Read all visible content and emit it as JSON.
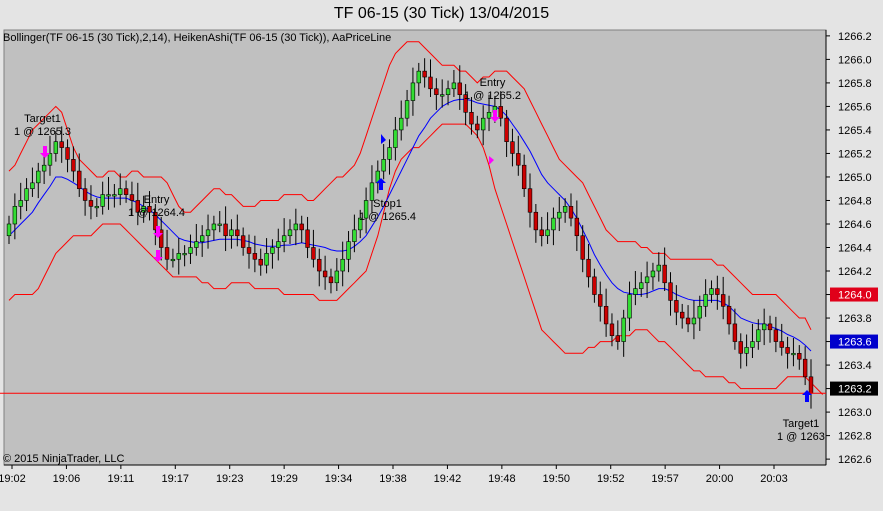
{
  "window": {
    "title": "TF 06-15 (30 Tick)  13/04/2015"
  },
  "indicators_label": "Bollinger(TF 06-15 (30 Tick),2,14), HeikenAshi(TF 06-15 (30 Tick)), AaPriceLine",
  "copyright": "© 2015 NinjaTrader, LLC",
  "colors": {
    "background": "#c0c0c0",
    "up_candle": "#33dd33",
    "down_candle": "#cc0000",
    "bollinger_band": "#ff0000",
    "bollinger_mid": "#0000ff",
    "signal_arrow": "#ff00ff",
    "stop_arrow": "#0000ff"
  },
  "annotations": [
    {
      "id": "target1_left",
      "line1": "Target1",
      "line2": "1 @ 1265.3"
    },
    {
      "id": "entry_left",
      "line1": "Entry",
      "line2": "1 @ 1264.4"
    },
    {
      "id": "stop1",
      "line1": "Stop1",
      "line2": "1 @ 1265.4"
    },
    {
      "id": "entry_right",
      "line1": "Entry",
      "line2": "1 @ 1265.2"
    },
    {
      "id": "target1_right",
      "line1": "Target1",
      "line2": "1 @ 1263"
    }
  ],
  "price_tags": [
    {
      "label": "1264.0",
      "value": 1264.0,
      "bg": "#e0001a",
      "fg": "#ffffff"
    },
    {
      "label": "1263.6",
      "value": 1263.6,
      "bg": "#0000cc",
      "fg": "#ffffff"
    },
    {
      "label": "1263.2",
      "value": 1263.2,
      "bg": "#000000",
      "fg": "#ffffff"
    }
  ],
  "chart_data": {
    "type": "candlestick",
    "title": "TF 06-15 (30 Tick)  13/04/2015",
    "ylim": [
      1262.55,
      1266.25
    ],
    "y_ticks": [
      "1262.6",
      "1262.8",
      "1263.0",
      "1263.2",
      "1263.4",
      "1263.6",
      "1263.8",
      "1264.0",
      "1264.2",
      "1264.4",
      "1264.6",
      "1264.8",
      "1265.0",
      "1265.2",
      "1265.4",
      "1265.6",
      "1265.8",
      "1266.0",
      "1266.2"
    ],
    "x_ticks": [
      "19:02",
      "19:06",
      "19:11",
      "19:17",
      "19:23",
      "19:29",
      "19:34",
      "19:38",
      "19:42",
      "19:48",
      "19:50",
      "19:52",
      "19:57",
      "20:00",
      "20:03"
    ],
    "price_line": 1263.16,
    "close": [
      1264.6,
      1264.75,
      1264.8,
      1264.9,
      1264.95,
      1265.05,
      1265.1,
      1265.2,
      1265.3,
      1265.25,
      1265.15,
      1265.05,
      1264.9,
      1264.8,
      1264.75,
      1264.75,
      1264.85,
      1264.85,
      1264.85,
      1264.9,
      1264.85,
      1264.8,
      1264.7,
      1264.75,
      1264.7,
      1264.55,
      1264.4,
      1264.3,
      1264.3,
      1264.35,
      1264.35,
      1264.4,
      1264.45,
      1264.5,
      1264.55,
      1264.6,
      1264.6,
      1264.5,
      1264.55,
      1264.5,
      1264.4,
      1264.35,
      1264.3,
      1264.25,
      1264.35,
      1264.4,
      1264.45,
      1264.5,
      1264.55,
      1264.6,
      1264.55,
      1264.4,
      1264.3,
      1264.2,
      1264.15,
      1264.1,
      1264.2,
      1264.3,
      1264.45,
      1264.55,
      1264.65,
      1264.8,
      1264.95,
      1265.05,
      1265.15,
      1265.25,
      1265.4,
      1265.5,
      1265.65,
      1265.8,
      1265.9,
      1265.85,
      1265.75,
      1265.7,
      1265.7,
      1265.75,
      1265.8,
      1265.7,
      1265.55,
      1265.45,
      1265.4,
      1265.5,
      1265.55,
      1265.6,
      1265.5,
      1265.3,
      1265.2,
      1265.1,
      1264.9,
      1264.7,
      1264.55,
      1264.5,
      1264.55,
      1264.65,
      1264.7,
      1264.75,
      1264.65,
      1264.5,
      1264.3,
      1264.15,
      1264.0,
      1263.9,
      1263.75,
      1263.65,
      1263.6,
      1263.8,
      1264.0,
      1264.05,
      1264.1,
      1264.15,
      1264.2,
      1264.25,
      1264.1,
      1263.95,
      1263.85,
      1263.8,
      1263.75,
      1263.8,
      1263.9,
      1264.0,
      1264.05,
      1264.0,
      1263.9,
      1263.75,
      1263.6,
      1263.5,
      1263.55,
      1263.6,
      1263.7,
      1263.75,
      1263.7,
      1263.6,
      1263.55,
      1263.5,
      1263.5,
      1263.45,
      1263.3,
      1263.16
    ],
    "bollinger": {
      "period": 14,
      "std_dev": 2,
      "upper": [
        1265.05,
        1265.1,
        1265.2,
        1265.3,
        1265.4,
        1265.45,
        1265.5,
        1265.55,
        1265.6,
        1265.55,
        1265.4,
        1265.25,
        1265.15,
        1265.1,
        1265.05,
        1265.0,
        1265.0,
        1265.05,
        1265.05,
        1265.0,
        1265.0,
        1265.05,
        1265.05,
        1265.0,
        1265.0,
        1265.0,
        1265.0,
        1264.95,
        1264.85,
        1264.75,
        1264.7,
        1264.7,
        1264.75,
        1264.8,
        1264.85,
        1264.9,
        1264.9,
        1264.85,
        1264.85,
        1264.8,
        1264.75,
        1264.75,
        1264.75,
        1264.8,
        1264.8,
        1264.8,
        1264.8,
        1264.85,
        1264.85,
        1264.85,
        1264.85,
        1264.8,
        1264.8,
        1264.85,
        1264.9,
        1264.95,
        1265.0,
        1265.0,
        1265.05,
        1265.1,
        1265.2,
        1265.35,
        1265.5,
        1265.65,
        1265.8,
        1265.95,
        1266.05,
        1266.1,
        1266.15,
        1266.15,
        1266.15,
        1266.1,
        1266.05,
        1266.0,
        1265.95,
        1265.95,
        1265.95,
        1265.9,
        1265.9,
        1265.85,
        1265.8,
        1265.85,
        1265.85,
        1265.9,
        1265.9,
        1265.9,
        1265.85,
        1265.8,
        1265.75,
        1265.65,
        1265.55,
        1265.45,
        1265.35,
        1265.25,
        1265.15,
        1265.1,
        1265.05,
        1265.0,
        1264.95,
        1264.85,
        1264.75,
        1264.65,
        1264.55,
        1264.5,
        1264.45,
        1264.45,
        1264.45,
        1264.45,
        1264.4,
        1264.4,
        1264.35,
        1264.35,
        1264.35,
        1264.3,
        1264.3,
        1264.3,
        1264.3,
        1264.3,
        1264.3,
        1264.3,
        1264.3,
        1264.25,
        1264.25,
        1264.2,
        1264.15,
        1264.1,
        1264.05,
        1264.0,
        1264.0,
        1264.0,
        1264.0,
        1264.0,
        1263.95,
        1263.9,
        1263.85,
        1263.8,
        1263.8,
        1263.7
      ],
      "middle": [
        1264.5,
        1264.55,
        1264.6,
        1264.65,
        1264.7,
        1264.78,
        1264.85,
        1264.92,
        1265.0,
        1265.0,
        1264.98,
        1264.95,
        1264.92,
        1264.88,
        1264.85,
        1264.83,
        1264.82,
        1264.82,
        1264.82,
        1264.82,
        1264.82,
        1264.8,
        1264.78,
        1264.75,
        1264.72,
        1264.68,
        1264.63,
        1264.58,
        1264.53,
        1264.48,
        1264.46,
        1264.45,
        1264.44,
        1264.44,
        1264.45,
        1264.46,
        1264.47,
        1264.47,
        1264.47,
        1264.47,
        1264.46,
        1264.45,
        1264.43,
        1264.42,
        1264.41,
        1264.41,
        1264.41,
        1264.42,
        1264.42,
        1264.43,
        1264.44,
        1264.43,
        1264.42,
        1264.41,
        1264.4,
        1264.38,
        1264.37,
        1264.37,
        1264.38,
        1264.41,
        1264.45,
        1264.5,
        1264.58,
        1264.66,
        1264.75,
        1264.85,
        1264.95,
        1265.05,
        1265.15,
        1265.25,
        1265.35,
        1265.42,
        1265.5,
        1265.55,
        1265.6,
        1265.63,
        1265.65,
        1265.66,
        1265.66,
        1265.65,
        1265.63,
        1265.62,
        1265.61,
        1265.6,
        1265.57,
        1265.52,
        1265.45,
        1265.38,
        1265.3,
        1265.22,
        1265.12,
        1265.02,
        1264.95,
        1264.9,
        1264.85,
        1264.8,
        1264.73,
        1264.65,
        1264.55,
        1264.45,
        1264.34,
        1264.25,
        1264.17,
        1264.1,
        1264.05,
        1264.02,
        1264.01,
        1264.0,
        1264.0,
        1264.01,
        1264.03,
        1264.05,
        1264.05,
        1264.03,
        1264.0,
        1263.98,
        1263.96,
        1263.95,
        1263.95,
        1263.95,
        1263.95,
        1263.95,
        1263.93,
        1263.9,
        1263.85,
        1263.8,
        1263.78,
        1263.76,
        1263.75,
        1263.75,
        1263.73,
        1263.71,
        1263.69,
        1263.66,
        1263.64,
        1263.61,
        1263.57,
        1263.52
      ],
      "lower": [
        1263.95,
        1264.0,
        1264.0,
        1264.0,
        1264.0,
        1264.05,
        1264.15,
        1264.25,
        1264.35,
        1264.4,
        1264.45,
        1264.5,
        1264.5,
        1264.5,
        1264.5,
        1264.55,
        1264.6,
        1264.6,
        1264.6,
        1264.6,
        1264.55,
        1264.5,
        1264.45,
        1264.4,
        1264.35,
        1264.3,
        1264.25,
        1264.2,
        1264.15,
        1264.15,
        1264.15,
        1264.15,
        1264.15,
        1264.1,
        1264.1,
        1264.05,
        1264.05,
        1264.05,
        1264.1,
        1264.1,
        1264.1,
        1264.1,
        1264.05,
        1264.05,
        1264.05,
        1264.05,
        1264.05,
        1264.0,
        1264.0,
        1264.0,
        1264.0,
        1264.0,
        1264.0,
        1263.95,
        1263.95,
        1263.95,
        1263.95,
        1264.0,
        1264.05,
        1264.1,
        1264.15,
        1264.2,
        1264.35,
        1264.5,
        1264.7,
        1264.9,
        1265.05,
        1265.15,
        1265.2,
        1265.25,
        1265.25,
        1265.3,
        1265.35,
        1265.4,
        1265.45,
        1265.45,
        1265.45,
        1265.45,
        1265.45,
        1265.4,
        1265.35,
        1265.25,
        1265.1,
        1264.9,
        1264.75,
        1264.6,
        1264.45,
        1264.3,
        1264.15,
        1264.0,
        1263.85,
        1263.7,
        1263.65,
        1263.6,
        1263.55,
        1263.5,
        1263.5,
        1263.5,
        1263.5,
        1263.55,
        1263.55,
        1263.6,
        1263.6,
        1263.6,
        1263.65,
        1263.65,
        1263.65,
        1263.7,
        1263.7,
        1263.7,
        1263.65,
        1263.6,
        1263.6,
        1263.55,
        1263.5,
        1263.45,
        1263.4,
        1263.35,
        1263.35,
        1263.3,
        1263.3,
        1263.3,
        1263.3,
        1263.25,
        1263.25,
        1263.2,
        1263.2,
        1263.2,
        1263.2,
        1263.2,
        1263.2,
        1263.2,
        1263.25,
        1263.3,
        1263.3,
        1263.3,
        1263.3,
        1263.25,
        1263.2,
        1263.15
      ]
    }
  }
}
